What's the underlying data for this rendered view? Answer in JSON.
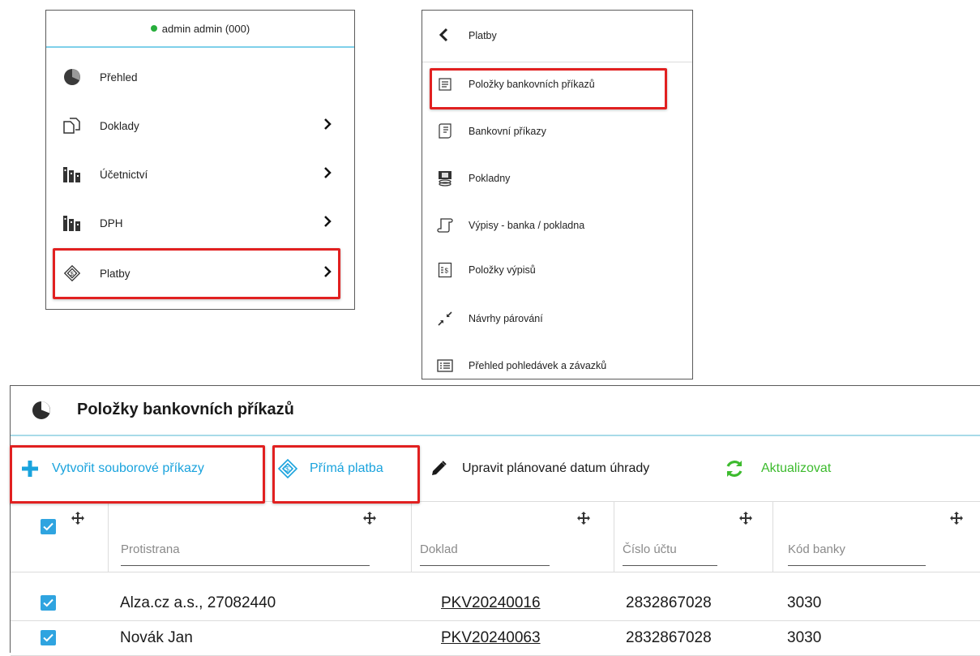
{
  "user_menu": {
    "user_label": "admin admin (000)",
    "items": [
      {
        "label": "Přehled",
        "icon": "pie-chart-icon",
        "has_submenu": false
      },
      {
        "label": "Doklady",
        "icon": "documents-icon",
        "has_submenu": true
      },
      {
        "label": "Účetnictví",
        "icon": "ledger-icon",
        "has_submenu": true
      },
      {
        "label": "DPH",
        "icon": "ledger-icon",
        "has_submenu": true
      },
      {
        "label": "Platby",
        "icon": "payment-icon",
        "has_submenu": true
      }
    ],
    "chevron": "›"
  },
  "submenu": {
    "title": "Platby",
    "items": [
      {
        "label": "Položky bankovních příkazů",
        "icon": "list-document-icon"
      },
      {
        "label": "Bankovní příkazy",
        "icon": "bank-order-icon"
      },
      {
        "label": "Pokladny",
        "icon": "cash-register-icon"
      },
      {
        "label": "Výpisy - banka / pokladna",
        "icon": "scroll-icon"
      },
      {
        "label": "Položky výpisů",
        "icon": "statement-items-icon"
      },
      {
        "label": "Návrhy párování",
        "icon": "pairing-arrows-icon"
      },
      {
        "label": "Přehled pohledávek a závazků",
        "icon": "table-list-icon"
      }
    ]
  },
  "main": {
    "title": "Položky bankovních příkazů",
    "toolbar": {
      "create_label": "Vytvořit souborové příkazy",
      "direct_payment_label": "Přímá platba",
      "edit_date_label": "Upravit plánované datum úhrady",
      "refresh_label": "Aktualizovat"
    },
    "columns": [
      "Protistrana",
      "Doklad",
      "Číslo účtu",
      "Kód banky"
    ],
    "rows": [
      {
        "counterparty": "Alza.cz a.s., 27082440",
        "document": "PKV20240016",
        "account": "2832867028",
        "bank_code": "3030",
        "checked": true
      },
      {
        "counterparty": "Novák Jan",
        "document": "PKV20240063",
        "account": "2832867028",
        "bank_code": "3030",
        "checked": true
      }
    ]
  },
  "colors": {
    "accent_blue": "#1aa3dd",
    "refresh_green": "#3dbb2e",
    "highlight_red": "#e12020",
    "online_dot": "#27ae3c",
    "checkbox_blue": "#2fa4e0"
  }
}
